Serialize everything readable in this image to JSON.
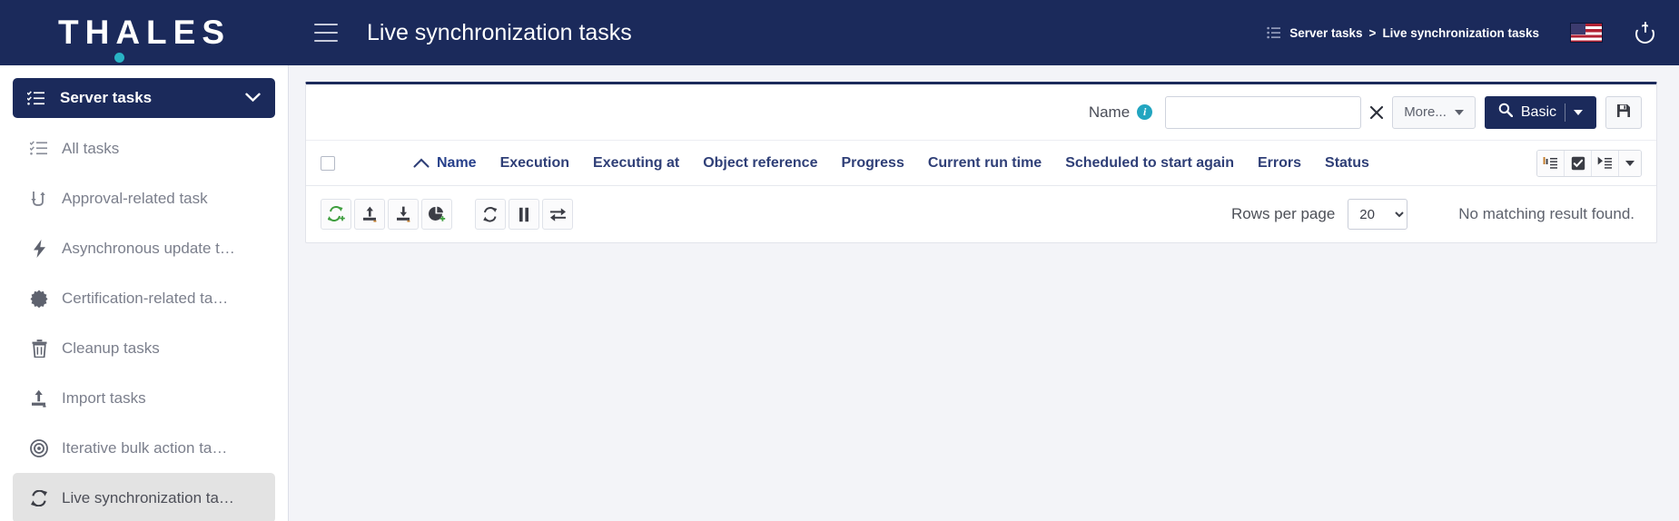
{
  "colors": {
    "brand_navy": "#1b2a5b",
    "accent_teal": "#29b3c4",
    "page_bg": "#f3f4f8",
    "header_text": "#2f3f77",
    "muted_text": "#7b7f8c",
    "selected_bg": "#e3e3e3",
    "info_badge": "#22a5c0",
    "green_accent": "#3f9e3f"
  },
  "topbar": {
    "logo": "THALES",
    "logo_dot_icon": "teal-dot",
    "menu_icon": "hamburger-icon",
    "page_title": "Live synchronization tasks",
    "breadcrumb_icon": "list-icon",
    "breadcrumb": {
      "parent": "Server tasks",
      "separator": ">",
      "current": "Live synchronization tasks"
    },
    "flag_icon": "us-flag-icon",
    "power_icon": "power-icon"
  },
  "sidebar": {
    "header": {
      "label": "Server tasks",
      "icon": "checklist-icon",
      "chevron": "⌄"
    },
    "items": [
      {
        "label": "All tasks",
        "icon": "checklist-icon",
        "selected": false
      },
      {
        "label": "Approval-related task",
        "icon": "approval-arrows-icon",
        "selected": false
      },
      {
        "label": "Asynchronous update t…",
        "icon": "lightning-bolt-icon",
        "selected": false
      },
      {
        "label": "Certification-related ta…",
        "icon": "certificate-badge-icon",
        "selected": false
      },
      {
        "label": "Cleanup tasks",
        "icon": "trash-icon",
        "selected": false
      },
      {
        "label": "Import tasks",
        "icon": "import-upload-icon",
        "selected": false
      },
      {
        "label": "Iterative bulk action ta…",
        "icon": "target-circles-icon",
        "selected": false
      },
      {
        "label": "Live synchronization ta…",
        "icon": "sync-arrows-icon",
        "selected": true
      }
    ]
  },
  "search": {
    "name_label": "Name",
    "info_icon": "info-icon",
    "input_value": "",
    "input_placeholder": "",
    "clear_icon": "close-x-icon",
    "more_button": "More...",
    "more_caret_icon": "chevron-down-icon",
    "basic_button": "Basic",
    "basic_search_icon": "search-icon",
    "basic_caret_icon": "chevron-down-icon",
    "save_button_icon": "floppy-disk-save-icon"
  },
  "table": {
    "select_all_checkbox": "unchecked",
    "sort_indicator_icon": "sort-ascending-caret-icon",
    "columns": [
      "Name",
      "Execution",
      "Executing at",
      "Object reference",
      "Progress",
      "Current run time",
      "Scheduled to start again",
      "Errors",
      "Status"
    ],
    "header_tools": [
      {
        "icon": "column-config-icon",
        "active": false
      },
      {
        "icon": "checkbox-checked-icon",
        "active": true
      },
      {
        "icon": "run-list-icon",
        "active": false
      },
      {
        "icon": "chevron-down-icon",
        "active": false
      }
    ],
    "rows": [],
    "empty_message": "No matching result found."
  },
  "toolbar": {
    "group_one": [
      {
        "icon": "sync-add-icon"
      },
      {
        "icon": "import-upload-icon"
      },
      {
        "icon": "export-download-icon"
      },
      {
        "icon": "pie-chart-add-icon"
      }
    ],
    "group_two": [
      {
        "icon": "refresh-sync-icon"
      },
      {
        "icon": "pause-icon"
      },
      {
        "icon": "transfer-arrows-icon"
      }
    ]
  },
  "pagination": {
    "rows_per_page_label": "Rows per page",
    "rows_per_page_value": "20",
    "rows_per_page_options": [
      "20"
    ]
  }
}
